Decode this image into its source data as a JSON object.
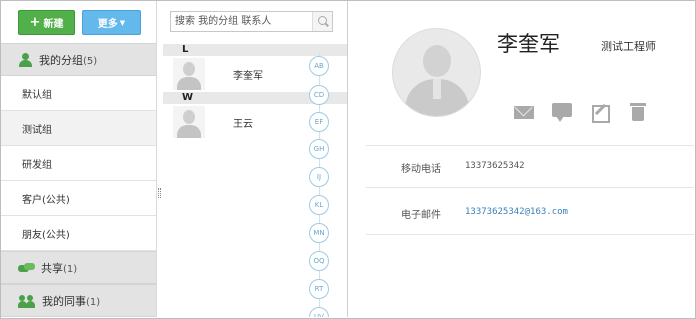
{
  "toolbar": {
    "new_label": "新建",
    "more_label": "更多"
  },
  "groups": {
    "my_groups": {
      "label": "我的分组",
      "count": "(5)"
    },
    "items": [
      {
        "label": "默认组"
      },
      {
        "label": "测试组"
      },
      {
        "label": "研发组"
      },
      {
        "label": "客户(公共)"
      },
      {
        "label": "朋友(公共)"
      }
    ],
    "shared": {
      "label": "共享",
      "count": "(1)"
    },
    "colleagues": {
      "label": "我的同事",
      "count": "(1)"
    }
  },
  "search": {
    "placeholder": "搜索 我的分组 联系人"
  },
  "contacts": {
    "sections": [
      {
        "letter": "L",
        "name": "李奎军"
      },
      {
        "letter": "W",
        "name": "王云"
      }
    ]
  },
  "alphabet": [
    "AB",
    "CD",
    "EF",
    "GH",
    "IJ",
    "KL",
    "MN",
    "OQ",
    "RT",
    "UV"
  ],
  "detail": {
    "name": "李奎军",
    "title": "测试工程师",
    "fields": [
      {
        "label": "移动电话",
        "value": "13373625342"
      },
      {
        "label": "电子邮件",
        "value": "13373625342@163.com"
      }
    ]
  },
  "colors": {
    "new_button": "#52b04a",
    "more_button": "#63b9eb",
    "link": "#3b7fb8",
    "alpha_circle": "#9ccbe6"
  }
}
